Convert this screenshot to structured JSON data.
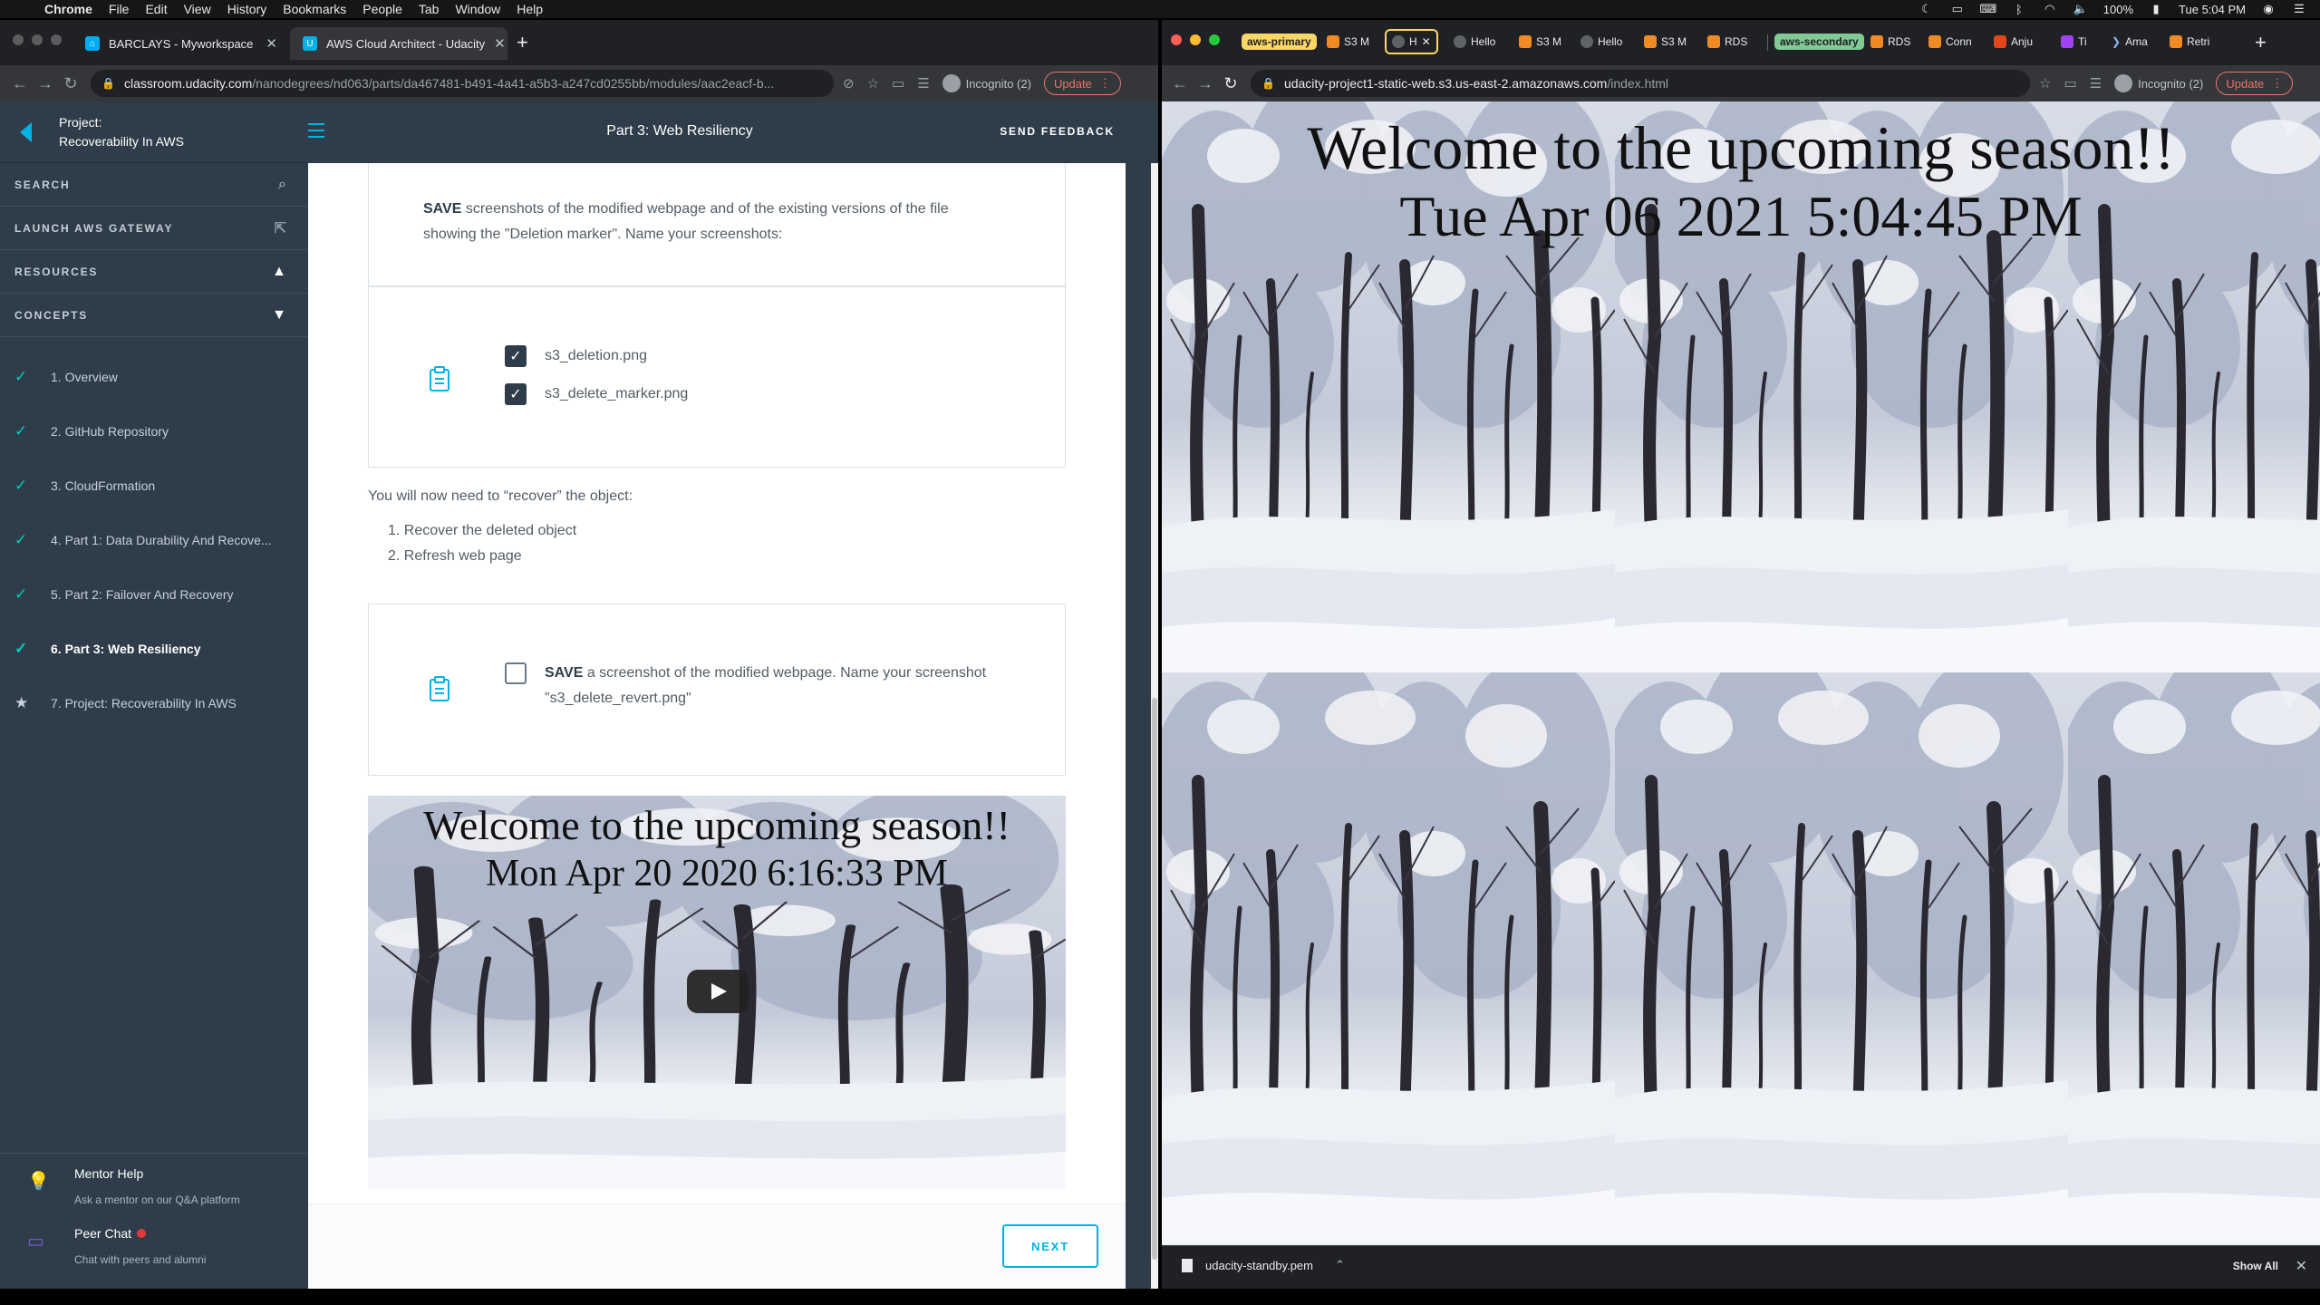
{
  "menubar": {
    "app": "Chrome",
    "items": [
      "File",
      "Edit",
      "View",
      "History",
      "Bookmarks",
      "People",
      "Tab",
      "Window",
      "Help"
    ],
    "battery": "100%",
    "clock": "Tue 5:04 PM"
  },
  "left_window": {
    "tabs": [
      {
        "title": "BARCLAYS - Myworkspace"
      },
      {
        "title": "AWS Cloud Architect - Udacity"
      }
    ],
    "url_host": "classroom.udacity.com",
    "url_path": "/nanodegrees/nd063/parts/da467481-b491-4a41-a5b3-a247cd0255bb/modules/aac2eacf-b...",
    "incognito": "Incognito (2)",
    "update": "Update"
  },
  "sidebar": {
    "project_label": "Project:",
    "project_name": "Recoverability In AWS",
    "search": "SEARCH",
    "launch": "LAUNCH AWS GATEWAY",
    "resources": "RESOURCES",
    "concepts": "CONCEPTS",
    "items": [
      {
        "label": "1. Overview",
        "status": "done"
      },
      {
        "label": "2. GitHub Repository",
        "status": "done"
      },
      {
        "label": "3. CloudFormation",
        "status": "done"
      },
      {
        "label": "4. Part 1: Data Durability And Recove...",
        "status": "done"
      },
      {
        "label": "5. Part 2: Failover And Recovery",
        "status": "done"
      },
      {
        "label": "6. Part 3: Web Resiliency",
        "status": "current"
      },
      {
        "label": "7. Project: Recoverability In AWS",
        "status": "project"
      }
    ],
    "mentor_title": "Mentor Help",
    "mentor_sub": "Ask a mentor on our Q&A platform",
    "peer_title": "Peer Chat",
    "peer_sub": "Chat with peers and alumni"
  },
  "topbar": {
    "title": "Part 3: Web Resiliency",
    "feedback": "SEND FEEDBACK"
  },
  "content": {
    "card1_bold": "SAVE",
    "card1_text": " screenshots of the modified webpage and of the existing versions of the file showing the \"Deletion marker\". Name your screenshots:",
    "checklist1": [
      {
        "label": "s3_deletion.png",
        "checked": true
      },
      {
        "label": "s3_delete_marker.png",
        "checked": true
      }
    ],
    "recover_intro": "You will now need to “recover” the object:",
    "steps": [
      "1. Recover the deleted object",
      "2. Refresh web page"
    ],
    "card3_bold": "SAVE",
    "card3_line1": " a screenshot of the modified webpage. Name your screenshot",
    "card3_line2": "\"s3_delete_revert.png\"",
    "card3_checked": false,
    "video_line1": "Welcome to the upcoming season!!",
    "video_line2": "Mon Apr 20 2020 6:16:33 PM",
    "next": "NEXT"
  },
  "right_window": {
    "groups": [
      {
        "name": "aws-primary",
        "color": "#fdd663"
      },
      {
        "name": "aws-secondary",
        "color": "#81c995"
      }
    ],
    "tabs": [
      "S3 M",
      "H",
      "Hello",
      "S3 M",
      "Hello",
      "S3 M",
      "RDS",
      "RDS",
      "Conn",
      "Anju",
      "Ti",
      "Ama",
      "Retri"
    ],
    "url_host": "udacity-project1-static-web.s3.us-east-2.amazonaws.com",
    "url_path": "/index.html",
    "incognito": "Incognito (2)",
    "update": "Update",
    "headline1": "Welcome to the upcoming season!!",
    "headline2": "Tue Apr 06 2021 5:04:45 PM",
    "download_file": "udacity-standby.pem",
    "show_all": "Show All"
  }
}
